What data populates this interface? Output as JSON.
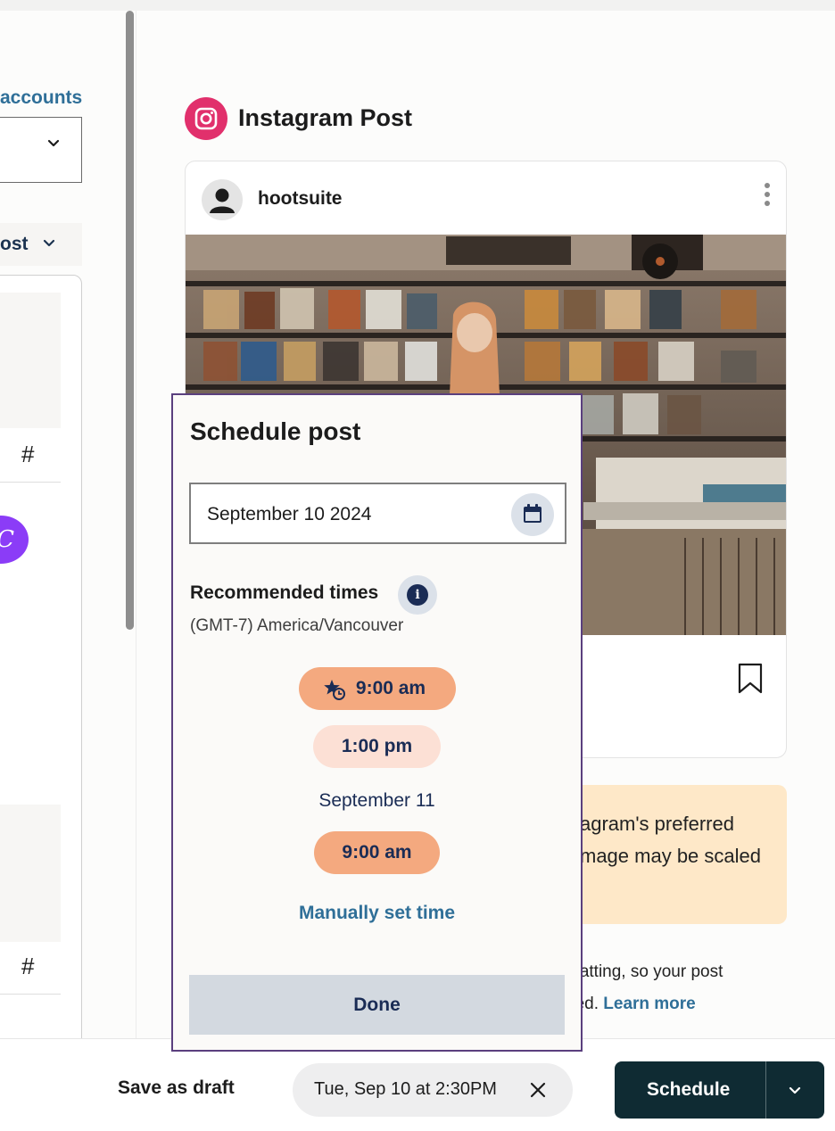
{
  "left_pane": {
    "accounts_link": "accounts",
    "post_type_label": "ost",
    "hash_symbol": "#",
    "canva_letter": "C"
  },
  "preview": {
    "network_title": "Instagram Post",
    "account_handle": "hootsuite",
    "warning_lines": [
      "agram's preferred",
      "mage may be scaled"
    ],
    "info_lines": [
      "matting, so your post",
      "hed."
    ],
    "learn_more": "Learn more"
  },
  "schedule_popover": {
    "title": "Schedule post",
    "date_value": "September 10 2024",
    "recommended_label": "Recommended times",
    "timezone": "(GMT-7) America/Vancouver",
    "times_day1": [
      "9:00 am",
      "1:00 pm"
    ],
    "day2_label": "September 11",
    "times_day2": [
      "9:00 am"
    ],
    "manual_link": "Manually set time",
    "done_label": "Done"
  },
  "bottom_bar": {
    "save_draft": "Save as draft",
    "scheduled_date": "Tue, Sep 10 at 2:30PM",
    "schedule_label": "Schedule"
  },
  "colors": {
    "accent_link": "#2f6f98",
    "schedule_button": "#0f2b33",
    "best_time_pill": "#f4a97f",
    "good_time_pill": "#fce0d5",
    "popover_border": "#5a3f7e",
    "instagram_brand": "#e1306c",
    "warning_bg": "#fee8c8"
  },
  "icons": [
    "chevron-down-icon",
    "hash-icon",
    "canva-icon",
    "instagram-icon",
    "avatar-icon",
    "more-options-icon",
    "bookmark-icon",
    "calendar-icon",
    "info-icon",
    "star-clock-icon",
    "close-icon"
  ]
}
